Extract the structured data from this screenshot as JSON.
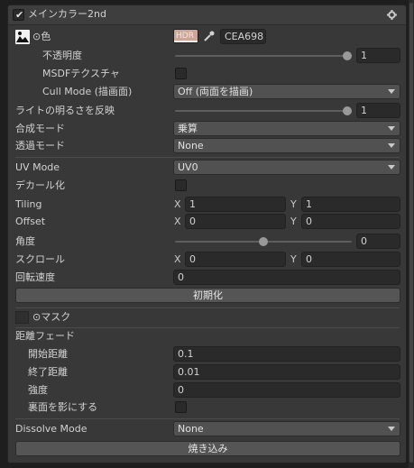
{
  "header": {
    "title": "メインカラー2nd",
    "enabled": true
  },
  "color": {
    "label": "⊙色",
    "hdr_badge": "HDR",
    "hex": "CEA698",
    "swatch": "#cea698"
  },
  "opacity": {
    "label": "不透明度",
    "value": "1",
    "fraction": 1.0
  },
  "msdf": {
    "label": "MSDFテクスチャ",
    "checked": false
  },
  "cullmode": {
    "label": "Cull Mode (描画面)",
    "value": "Off (両面を描画)"
  },
  "light": {
    "label": "ライトの明るさを反映",
    "value": "1",
    "fraction": 1.0
  },
  "blend": {
    "label": "合成モード",
    "value": "乗算"
  },
  "transparency": {
    "label": "透過モード",
    "value": "None"
  },
  "uvmode": {
    "label": "UV Mode",
    "value": "UV0"
  },
  "decal": {
    "label": "デカール化",
    "checked": false
  },
  "tiling": {
    "label": "Tiling",
    "x_label": "X",
    "x": "1",
    "y_label": "Y",
    "y": "1"
  },
  "offset": {
    "label": "Offset",
    "x_label": "X",
    "x": "0",
    "y_label": "Y",
    "y": "0"
  },
  "angle": {
    "label": "角度",
    "value": "0",
    "fraction": 0.5
  },
  "scroll": {
    "label": "スクロール",
    "x_label": "X",
    "x": "0",
    "y_label": "Y",
    "y": "0"
  },
  "rotation_speed": {
    "label": "回転速度",
    "value": "0"
  },
  "reset_button": "初期化",
  "mask": {
    "label": "⊙マスク"
  },
  "distance_fade": {
    "title": "距離フェード",
    "start": {
      "label": "開始距離",
      "value": "0.1"
    },
    "end": {
      "label": "終了距離",
      "value": "0.01"
    },
    "strength": {
      "label": "強度",
      "value": "0"
    },
    "backface": {
      "label": "裏面を影にする",
      "checked": false
    }
  },
  "dissolve": {
    "label": "Dissolve Mode",
    "value": "None"
  },
  "bake_button": "焼き込み",
  "icons": {
    "toggle": "check-icon",
    "settings": "gear-icon",
    "texture": "texture-thumbnail-icon",
    "picker": "eyedropper-icon"
  }
}
